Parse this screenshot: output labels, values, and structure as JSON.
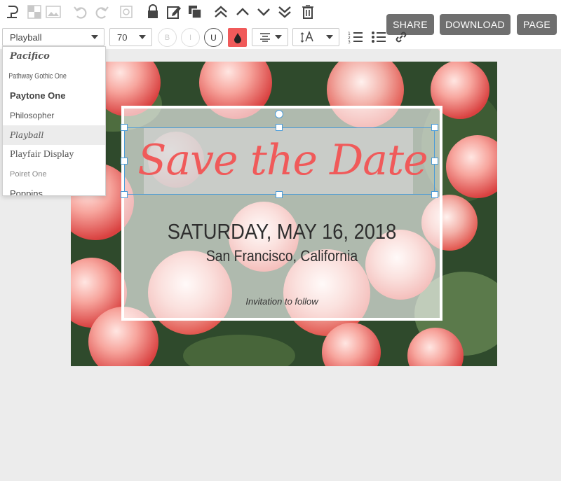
{
  "header": {
    "share_label": "SHARE",
    "download_label": "DOWNLOAD",
    "page_label": "PAGE"
  },
  "toolbar_icons": [
    "text-tool-icon",
    "background-pattern-icon",
    "image-icon",
    "undo-icon",
    "redo-icon",
    "crop-icon",
    "lock-icon",
    "edit-icon",
    "duplicate-icon",
    "bring-to-front-icon",
    "bring-forward-icon",
    "send-backward-icon",
    "send-to-back-icon",
    "trash-icon"
  ],
  "format_bar": {
    "font_value": "Playball",
    "size_value": "70",
    "bold_label": "B",
    "italic_label": "I",
    "underline_label": "U",
    "text_color": "#f05a5a"
  },
  "font_dropdown": {
    "options": [
      "Pacifico",
      "Pathway Gothic One",
      "Paytone One",
      "Philosopher",
      "Playball",
      "Playfair Display",
      "Poiret One",
      "Poppins"
    ],
    "selected": "Playball"
  },
  "card": {
    "headline": "Save the Date",
    "date": "SATURDAY, MAY 16, 2018",
    "location": "San Francisco, California",
    "note": "Invitation to follow"
  },
  "colors": {
    "accent": "#f05a5a",
    "selection": "#4a9bd8",
    "button_gray": "#6f6f6f"
  }
}
